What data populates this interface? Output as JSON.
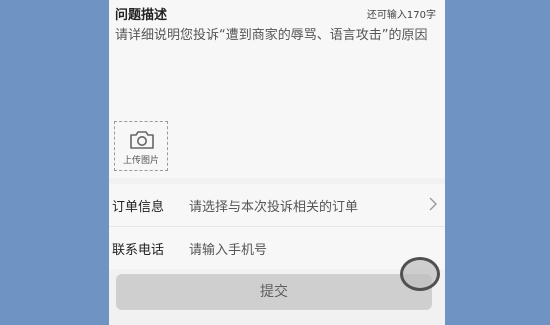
{
  "description": {
    "title": "问题描述",
    "remaining": "还可输入170字",
    "text": "请详细说明您投诉“遭到商家的辱骂、语言攻击”的原因",
    "upload_label": "上传图片",
    "upload_icon": "camera-icon"
  },
  "order_row": {
    "label": "订单信息",
    "value": "请选择与本次投诉相关的订单",
    "icon": "chevron-right-icon"
  },
  "phone_row": {
    "label": "联系电话",
    "placeholder": "请输入手机号"
  },
  "submit": {
    "label": "提交"
  }
}
